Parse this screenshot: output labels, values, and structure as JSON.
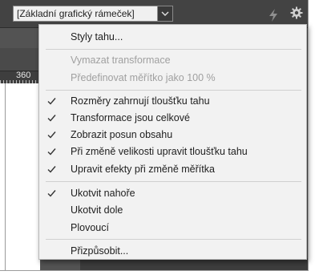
{
  "toolbar": {
    "style_select_value": "[Základní grafický rámeček]",
    "icons": [
      "chevron-down-icon",
      "lightning-icon",
      "gear-icon"
    ]
  },
  "ruler": {
    "label": "360"
  },
  "menu": {
    "items": [
      {
        "label": "Styly tahu...",
        "checked": false,
        "enabled": true
      },
      {
        "label": "Vymazat transformace",
        "checked": false,
        "enabled": false
      },
      {
        "label": "Předefinovat měřítko jako 100 %",
        "checked": false,
        "enabled": false
      },
      {
        "label": "Rozměry zahrnují tloušťku tahu",
        "checked": true,
        "enabled": true
      },
      {
        "label": "Transformace jsou celkové",
        "checked": true,
        "enabled": true
      },
      {
        "label": "Zobrazit posun obsahu",
        "checked": true,
        "enabled": true
      },
      {
        "label": "Při změně velikosti upravit tloušťku tahu",
        "checked": true,
        "enabled": true
      },
      {
        "label": "Upravit efekty při změně měřítka",
        "checked": true,
        "enabled": true
      },
      {
        "label": "Ukotvit nahoře",
        "checked": true,
        "enabled": true
      },
      {
        "label": "Ukotvit dole",
        "checked": false,
        "enabled": true
      },
      {
        "label": "Plovoucí",
        "checked": false,
        "enabled": true
      },
      {
        "label": "Přizpůsobit...",
        "checked": false,
        "enabled": true
      }
    ]
  },
  "colors": {
    "app_background": "#535353",
    "toolbar": "#434343",
    "menu_background": "#f2f2f2",
    "menu_text": "#1e1e1e",
    "menu_disabled_text": "#a0a0a0"
  }
}
